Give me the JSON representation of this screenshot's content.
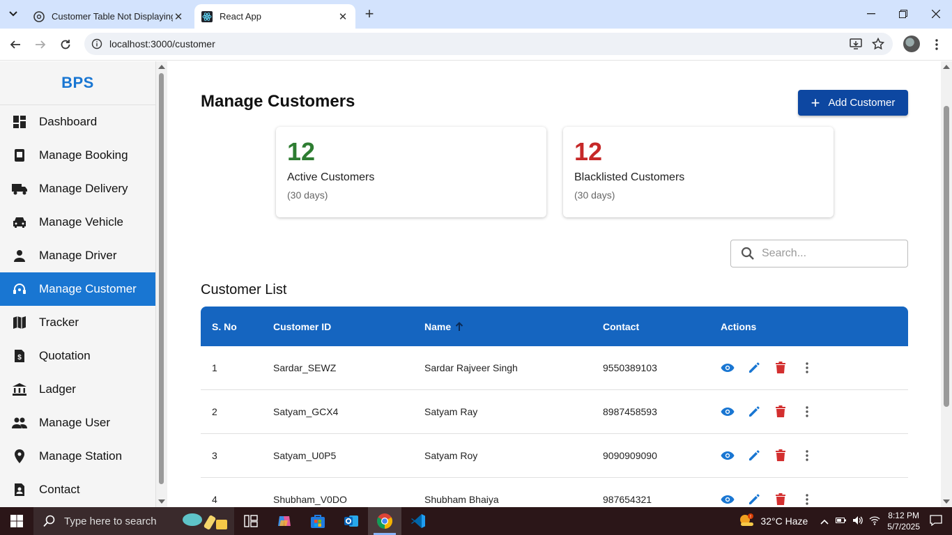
{
  "browser": {
    "tabs": [
      {
        "title": "Customer Table Not Displaying"
      },
      {
        "title": "React App"
      }
    ],
    "url": "localhost:3000/customer"
  },
  "sidebar": {
    "brand": "BPS",
    "items": [
      {
        "label": "Dashboard",
        "icon": "dashboard-icon"
      },
      {
        "label": "Manage Booking",
        "icon": "booking-icon"
      },
      {
        "label": "Manage Delivery",
        "icon": "truck-icon"
      },
      {
        "label": "Manage Vehicle",
        "icon": "car-icon"
      },
      {
        "label": "Manage Driver",
        "icon": "person-icon"
      },
      {
        "label": "Manage Customer",
        "icon": "headset-icon",
        "active": true
      },
      {
        "label": "Tracker",
        "icon": "map-icon"
      },
      {
        "label": "Quotation",
        "icon": "quotation-icon"
      },
      {
        "label": "Ladger",
        "icon": "bank-icon"
      },
      {
        "label": "Manage User",
        "icon": "people-icon"
      },
      {
        "label": "Manage Station",
        "icon": "location-icon"
      },
      {
        "label": "Contact",
        "icon": "contact-icon"
      }
    ]
  },
  "main": {
    "title": "Manage Customers",
    "add_button": "Add Customer",
    "stats": [
      {
        "value": "12",
        "label": "Active Customers",
        "sub": "(30 days)",
        "color": "#2e7d32"
      },
      {
        "value": "12",
        "label": "Blacklisted Customers",
        "sub": "(30 days)",
        "color": "#c62828"
      }
    ],
    "search_placeholder": "Search...",
    "list_title": "Customer List",
    "table": {
      "headers": [
        "S. No",
        "Customer ID",
        "Name",
        "Contact",
        "Actions"
      ],
      "rows": [
        {
          "sno": "1",
          "id": "Sardar_SEWZ",
          "name": "Sardar Rajveer Singh",
          "contact": "9550389103"
        },
        {
          "sno": "2",
          "id": "Satyam_GCX4",
          "name": "Satyam Ray",
          "contact": "8987458593"
        },
        {
          "sno": "3",
          "id": "Satyam_U0P5",
          "name": "Satyam Roy",
          "contact": "9090909090"
        },
        {
          "sno": "4",
          "id": "Shubham_V0DO",
          "name": "Shubham Bhaiya",
          "contact": "987654321"
        }
      ]
    }
  },
  "taskbar": {
    "search_placeholder": "Type here to search",
    "weather": "32°C  Haze",
    "time": "8:12 PM",
    "date": "5/7/2025"
  },
  "colors": {
    "primary": "#1976d2",
    "header": "#1565c0",
    "add_button": "#0d47a1",
    "delete": "#d32f2f"
  }
}
